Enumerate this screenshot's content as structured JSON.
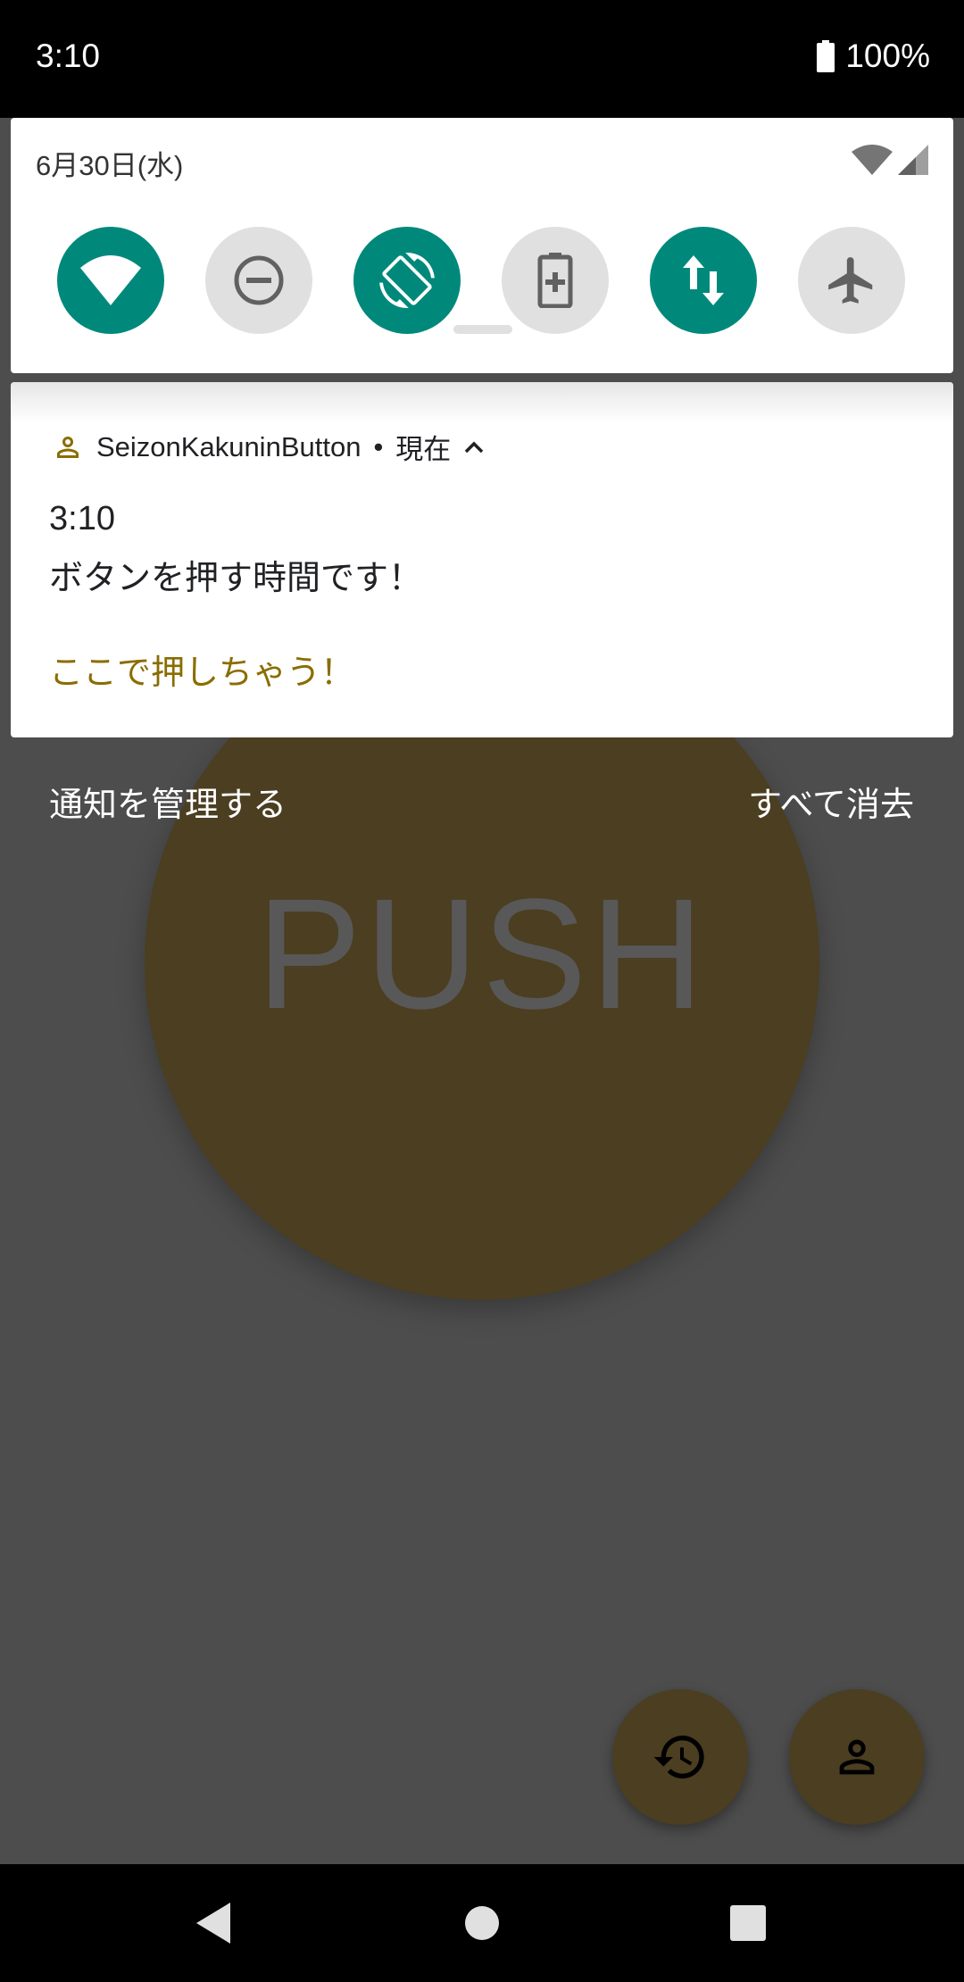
{
  "status_bar": {
    "time": "3:10",
    "battery_percent": "100%",
    "battery_icon": "battery-full-icon"
  },
  "quick_settings": {
    "date": "6月30日(水)",
    "signal_icons": [
      "wifi-signal-icon",
      "cell-signal-icon"
    ],
    "tiles": [
      {
        "name": "wifi",
        "icon": "wifi-icon",
        "state": "on"
      },
      {
        "name": "do-not-disturb",
        "icon": "do-not-disturb-icon",
        "state": "off"
      },
      {
        "name": "auto-rotate",
        "icon": "auto-rotate-icon",
        "state": "on"
      },
      {
        "name": "battery-saver",
        "icon": "battery-saver-icon",
        "state": "off"
      },
      {
        "name": "mobile-data",
        "icon": "mobile-data-icon",
        "state": "on"
      },
      {
        "name": "airplane-mode",
        "icon": "airplane-icon",
        "state": "off"
      }
    ],
    "active_color": "#00897b"
  },
  "notification": {
    "app_name": "SeizonKakuninButton",
    "separator": "•",
    "time_label": "現在",
    "title": "3:10",
    "text": "ボタンを押す時間です！",
    "action_label": "ここで押しちゃう！",
    "accent_color": "#8a6d00"
  },
  "shade_footer": {
    "manage_label": "通知を管理する",
    "clear_all_label": "すべて消去"
  },
  "app": {
    "push_label": "PUSH",
    "fab_history_icon": "history-icon",
    "fab_profile_icon": "person-icon"
  },
  "nav_bar": {
    "back_icon": "back-icon",
    "home_icon": "home-icon",
    "recents_icon": "recents-icon"
  }
}
